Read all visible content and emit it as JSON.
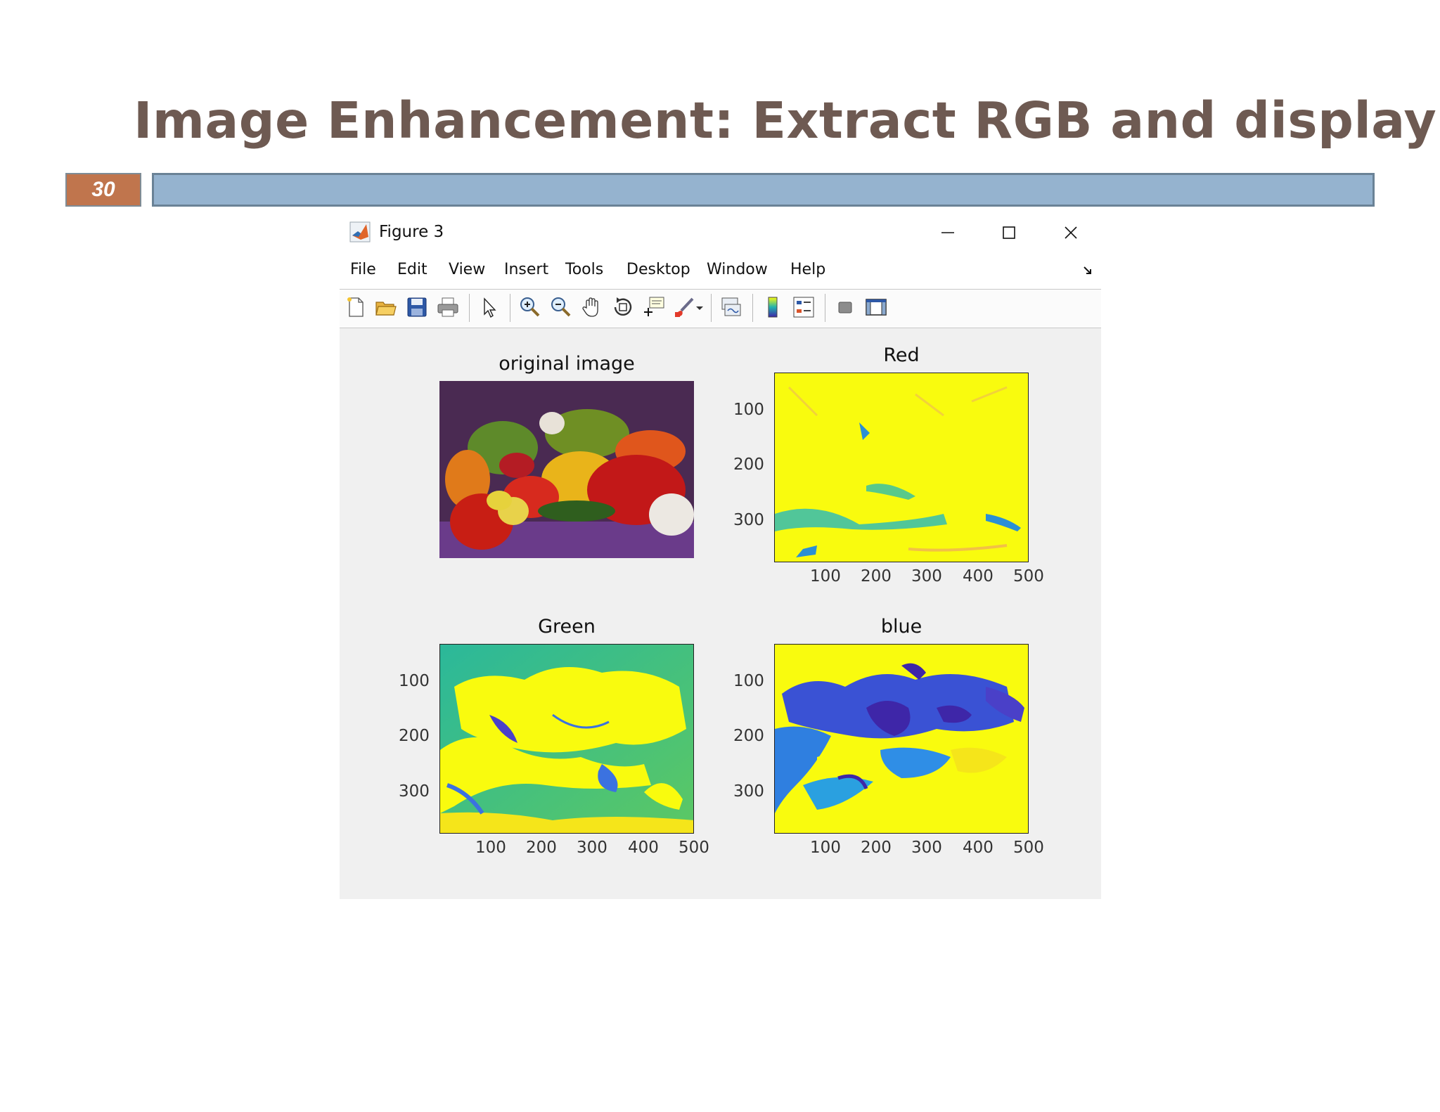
{
  "slide": {
    "title": "Image Enhancement: Extract RGB and display",
    "number": "30"
  },
  "window": {
    "title": "Figure 3",
    "controls": [
      "minimize-icon",
      "maximize-icon",
      "close-icon"
    ]
  },
  "menu": {
    "items": [
      "File",
      "Edit",
      "View",
      "Insert",
      "Tools",
      "Desktop",
      "Window",
      "Help"
    ]
  },
  "toolbar": {
    "icons": [
      "new-figure-icon",
      "open-file-icon",
      "save-icon",
      "print-icon",
      "edit-plot-arrow-icon",
      "zoom-in-icon",
      "zoom-out-icon",
      "pan-hand-icon",
      "rotate-3d-icon",
      "data-cursor-icon",
      "brush-icon",
      "brush-dropdown-icon",
      "link-plot-icon",
      "colorbar-icon",
      "legend-icon",
      "hide-plot-tools-icon",
      "show-plot-tools-icon"
    ]
  },
  "subplots": {
    "original": {
      "title": "original image"
    },
    "red": {
      "title": "Red",
      "yticks": [
        "100",
        "200",
        "300"
      ],
      "xticks": [
        "100",
        "200",
        "300",
        "400",
        "500"
      ]
    },
    "green": {
      "title": "Green",
      "yticks": [
        "100",
        "200",
        "300"
      ],
      "xticks": [
        "100",
        "200",
        "300",
        "400",
        "500"
      ]
    },
    "blue": {
      "title": "blue",
      "yticks": [
        "100",
        "200",
        "300"
      ],
      "xticks": [
        "100",
        "200",
        "300",
        "400",
        "500"
      ]
    }
  },
  "colors": {
    "title_text": "#6e5a52",
    "slide_number_bg": "#c0754d",
    "strip": "#95b3cf",
    "parula_yellow": "#f9fb0e",
    "parula_blue": "#3e26a8"
  }
}
